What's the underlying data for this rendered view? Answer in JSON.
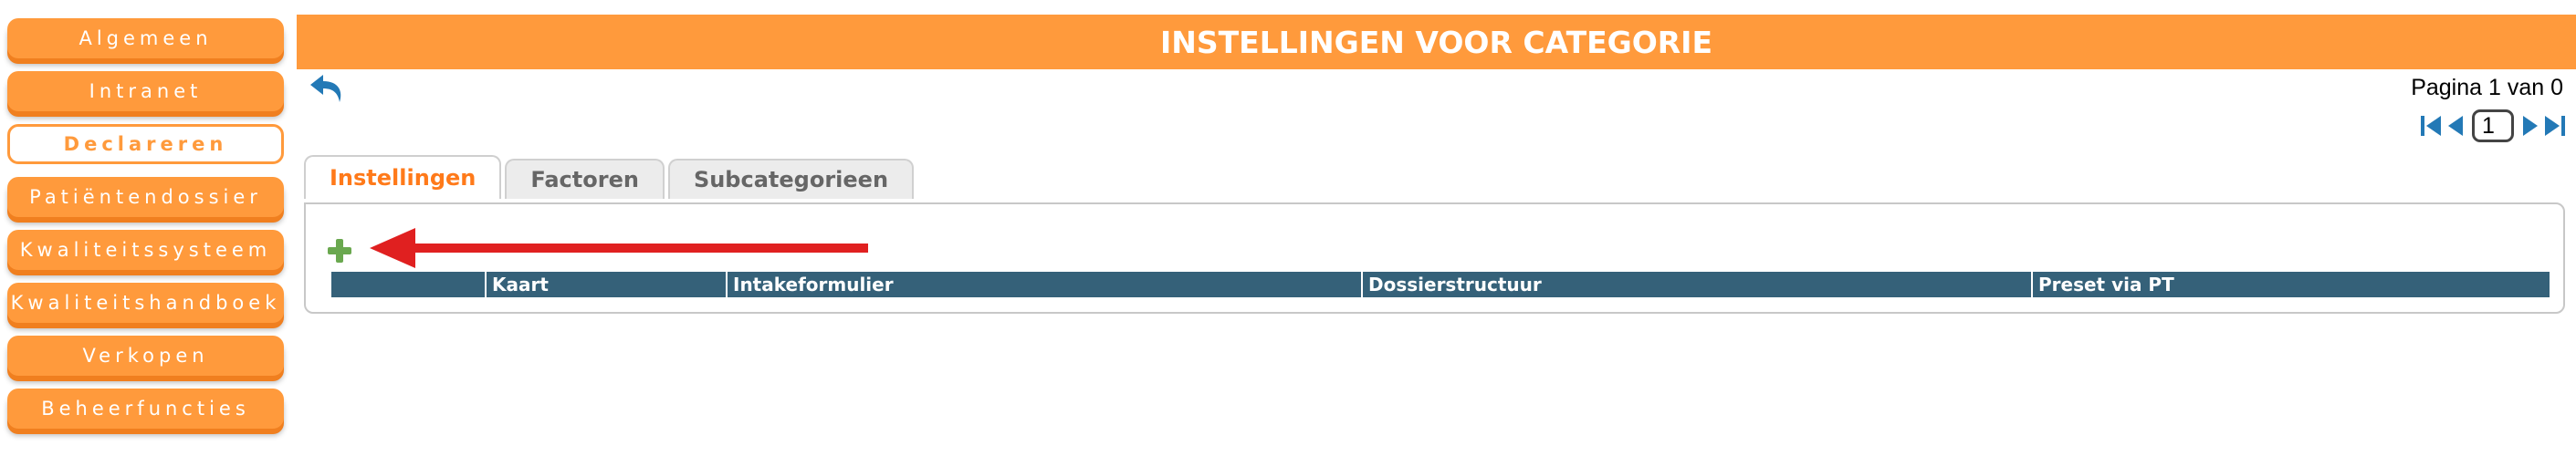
{
  "sidebar": {
    "items": [
      {
        "label": "Algemeen",
        "active": false
      },
      {
        "label": "Intranet",
        "active": false
      },
      {
        "label": "Declareren",
        "active": true
      },
      {
        "label": "Patiëntendossier",
        "active": false
      },
      {
        "label": "Kwaliteitssysteem",
        "active": false
      },
      {
        "label": "Kwaliteitshandboek",
        "active": false
      },
      {
        "label": "Verkopen",
        "active": false
      },
      {
        "label": "Beheerfuncties",
        "active": false
      }
    ]
  },
  "header": {
    "title": "INSTELLINGEN VOOR CATEGORIE"
  },
  "pagination": {
    "info": "Pagina 1 van 0",
    "current_page": "1"
  },
  "tabs": [
    {
      "label": "Instellingen",
      "active": true
    },
    {
      "label": "Factoren",
      "active": false
    },
    {
      "label": "Subcategorieen",
      "active": false
    }
  ],
  "table": {
    "columns": [
      "",
      "Kaart",
      "Intakeformulier",
      "Dossierstructuur",
      "Preset via PT"
    ]
  },
  "icons": {
    "back": "undo-arrow-icon",
    "add": "plus-icon",
    "first": "first-page-icon",
    "prev": "previous-page-icon",
    "next": "next-page-icon",
    "last": "last-page-icon",
    "annotation": "red-arrow-icon"
  },
  "colors": {
    "accent_orange": "#ff9a3c",
    "table_header": "#356179",
    "icon_blue": "#2379b6",
    "add_green": "#6aa84f",
    "annotation_red": "#e02020"
  }
}
